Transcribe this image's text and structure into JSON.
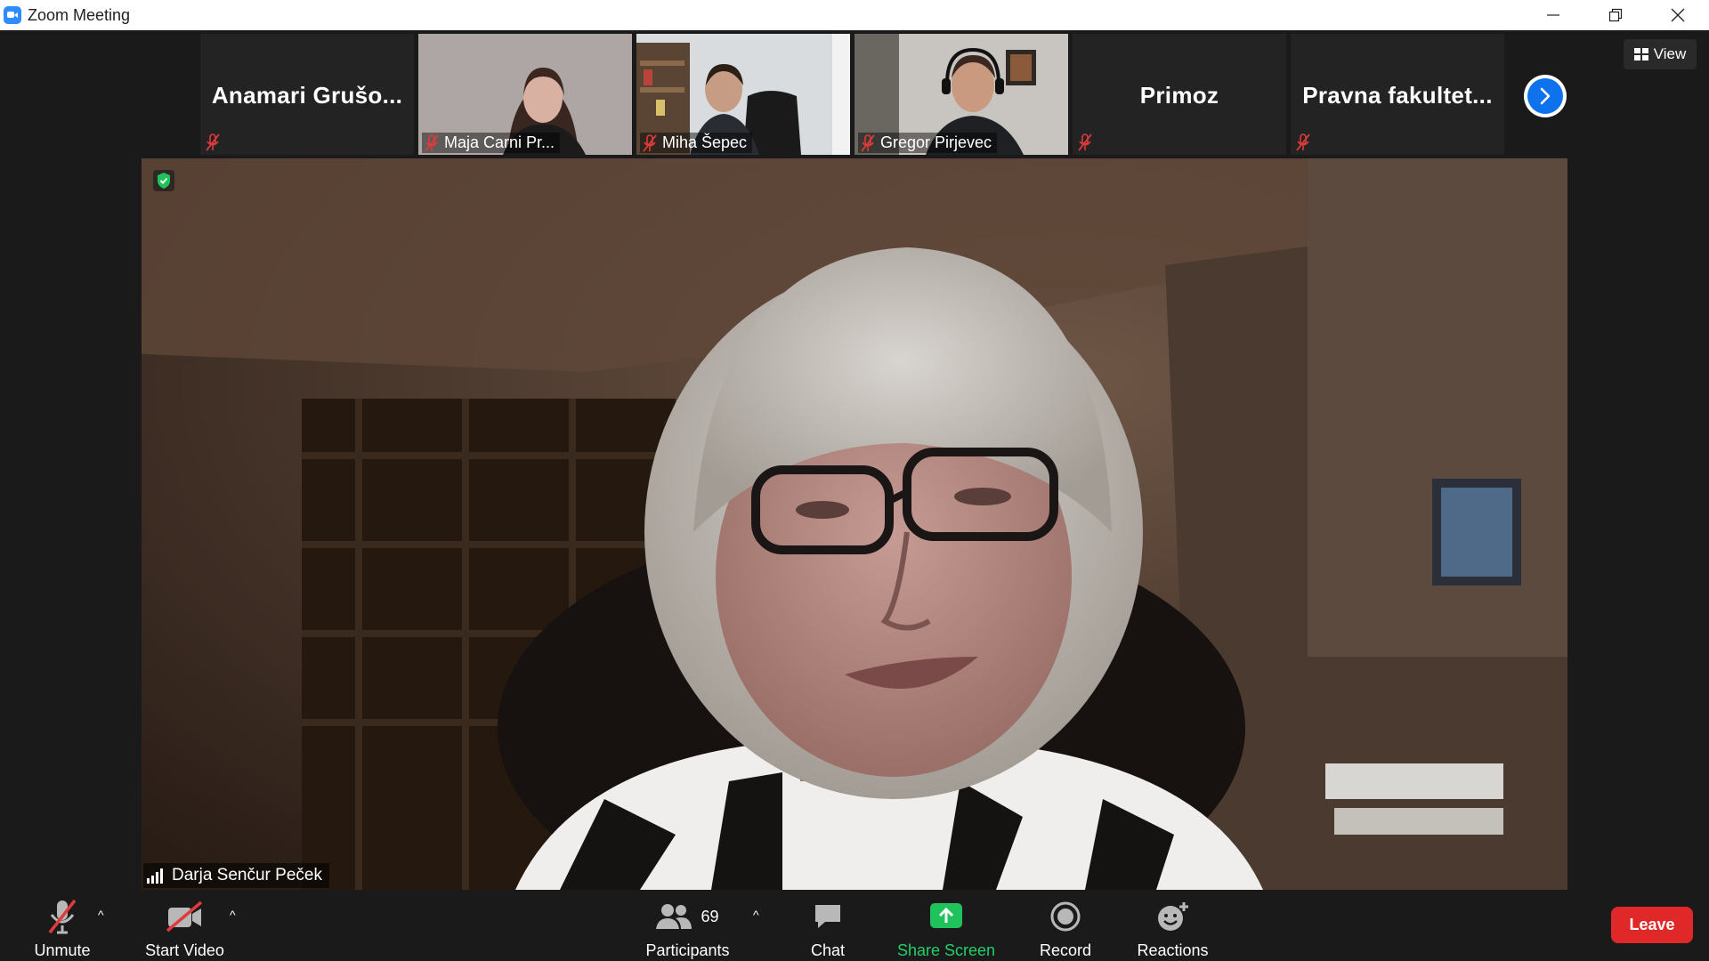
{
  "window": {
    "title": "Zoom Meeting"
  },
  "gallery": {
    "tiles": [
      {
        "name": "Anamari  Grušo...",
        "has_video": false,
        "muted": true
      },
      {
        "name": "Maja Carni Pr...",
        "has_video": true,
        "muted": true
      },
      {
        "name": "Miha Šepec",
        "has_video": true,
        "muted": true
      },
      {
        "name": "Gregor Pirjevec",
        "has_video": true,
        "muted": true
      },
      {
        "name": "Primoz",
        "has_video": false,
        "muted": true
      },
      {
        "name": "Pravna  fakultet...",
        "has_video": false,
        "muted": true
      }
    ]
  },
  "view_button": {
    "label": "View"
  },
  "main_speaker": {
    "name": "Darja Senčur Peček"
  },
  "toolbar": {
    "unmute": "Unmute",
    "start_video": "Start Video",
    "participants": "Participants",
    "participants_count": "69",
    "chat": "Chat",
    "share_screen": "Share Screen",
    "record": "Record",
    "reactions": "Reactions",
    "leave": "Leave"
  },
  "colors": {
    "accent_blue": "#0e72ed",
    "share_green": "#22d068",
    "leave_red": "#e02828",
    "muted_red": "#e03b3b"
  }
}
